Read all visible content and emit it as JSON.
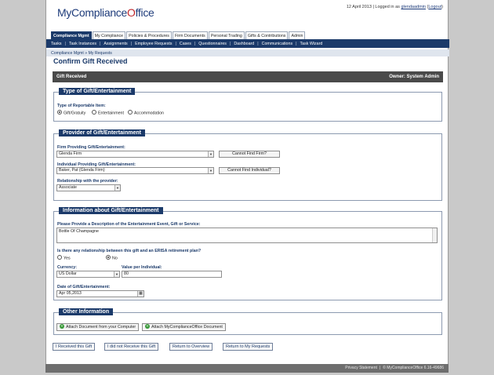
{
  "header": {
    "logo_main": "MyCompliance",
    "logo_o": "O",
    "logo_tail": "ffice",
    "date": "12 April 2013",
    "logged_in_prefix": "Logged in as",
    "username": "glendaadmin",
    "logout": "Logout"
  },
  "tabs": [
    "Compliance Mgmt",
    "My Compliance",
    "Policies & Procedures",
    "Firm Documents",
    "Personal Trading",
    "Gifts & Contributions",
    "Admin"
  ],
  "subnav": [
    "Tasks",
    "Task Instances",
    "Assignments",
    "Employee Requests",
    "Cases",
    "Questionnaires",
    "Dashboard",
    "Communications",
    "Task Wizard"
  ],
  "breadcrumb": "Compliance Mgmt » My Requests",
  "page": {
    "title": "Confirm Gift Received",
    "bar_left": "Gift Received",
    "bar_right": "Owner: System Admin"
  },
  "type_section": {
    "legend": "Type of Gift/Entertainment",
    "label": "Type of Reportable Item:",
    "options": [
      "Gift/Gratuity",
      "Entertainment",
      "Accommodation"
    ],
    "selected": 0
  },
  "provider_section": {
    "legend": "Provider of Gift/Entertainment",
    "firm_label": "Firm Providing Gift/Entertainment:",
    "firm_value": "Glenda Firm",
    "firm_button": "Cannot Find Firm?",
    "individual_label": "Individual Providing Gift/Entertainment:",
    "individual_value": "Baker, Pat (Glenda Firm)",
    "individual_button": "Cannot Find Individual?",
    "relationship_label": "Relationship with the provider:",
    "relationship_value": "Associate"
  },
  "info_section": {
    "legend": "Information about Gift/Entertainment",
    "description_label": "Please Provide a Description of the Entertainment Event, Gift or Service:",
    "description_value": "Bottle Of Champagne",
    "erisa_label": "Is there any relationship between this gift and an ERISA retirement plan?",
    "erisa_yes": "Yes",
    "erisa_no": "No",
    "currency_label": "Currency:",
    "currency_value": "US Dollar",
    "value_label": "Value per Individual:",
    "value_value": "80",
    "date_label": "Date of Gift/Entertainment:",
    "date_value": "Apr 05,2013"
  },
  "other_section": {
    "legend": "Other Information",
    "attach_computer": "Attach Document from your Computer",
    "attach_mco": "Attach MyComplianceOffice Document"
  },
  "actions": {
    "received": "I Received this Gift",
    "not_received": "I did not Receive this Gift",
    "overview": "Return to Overview",
    "my_requests": "Return to My Requests"
  },
  "footer": {
    "privacy": "Privacy Statement",
    "copyright": "© MyComplianceOffice 6.16-49686"
  }
}
